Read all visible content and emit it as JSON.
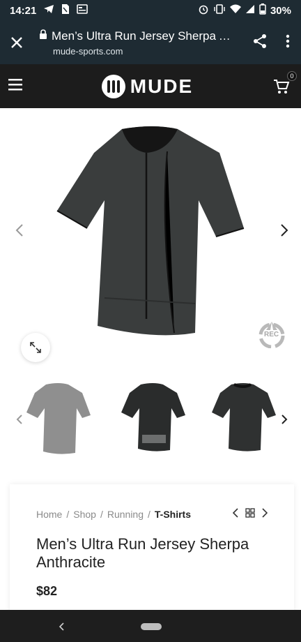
{
  "status": {
    "time": "14:21",
    "battery": "30%",
    "left_icons": [
      "telegram-icon",
      "sim-icon",
      "news-icon"
    ],
    "right_icons": [
      "alarm-icon",
      "vibrate-icon",
      "wifi-icon",
      "signal-icon",
      "battery-icon"
    ]
  },
  "browser": {
    "title": "Men’s Ultra Run Jersey Sherpa A…",
    "url": "mude-sports.com"
  },
  "site": {
    "logo_text": "MUDE",
    "cart_count": "0"
  },
  "gallery": {
    "rec_label": "REC",
    "thumb_colors": [
      "#8f8f8f",
      "#2a2c2c",
      "#2f3131"
    ]
  },
  "breadcrumb": {
    "items": [
      "Home",
      "Shop",
      "Running"
    ],
    "separator": "/",
    "current": "T-Shirts"
  },
  "product": {
    "title": "Men’s Ultra Run Jersey Sherpa Anthracite",
    "price": "$82"
  },
  "colors": {
    "chrome_bg": "#1e2b33",
    "header_bg": "#1c1c1c",
    "jersey": "#3a3d3d"
  }
}
